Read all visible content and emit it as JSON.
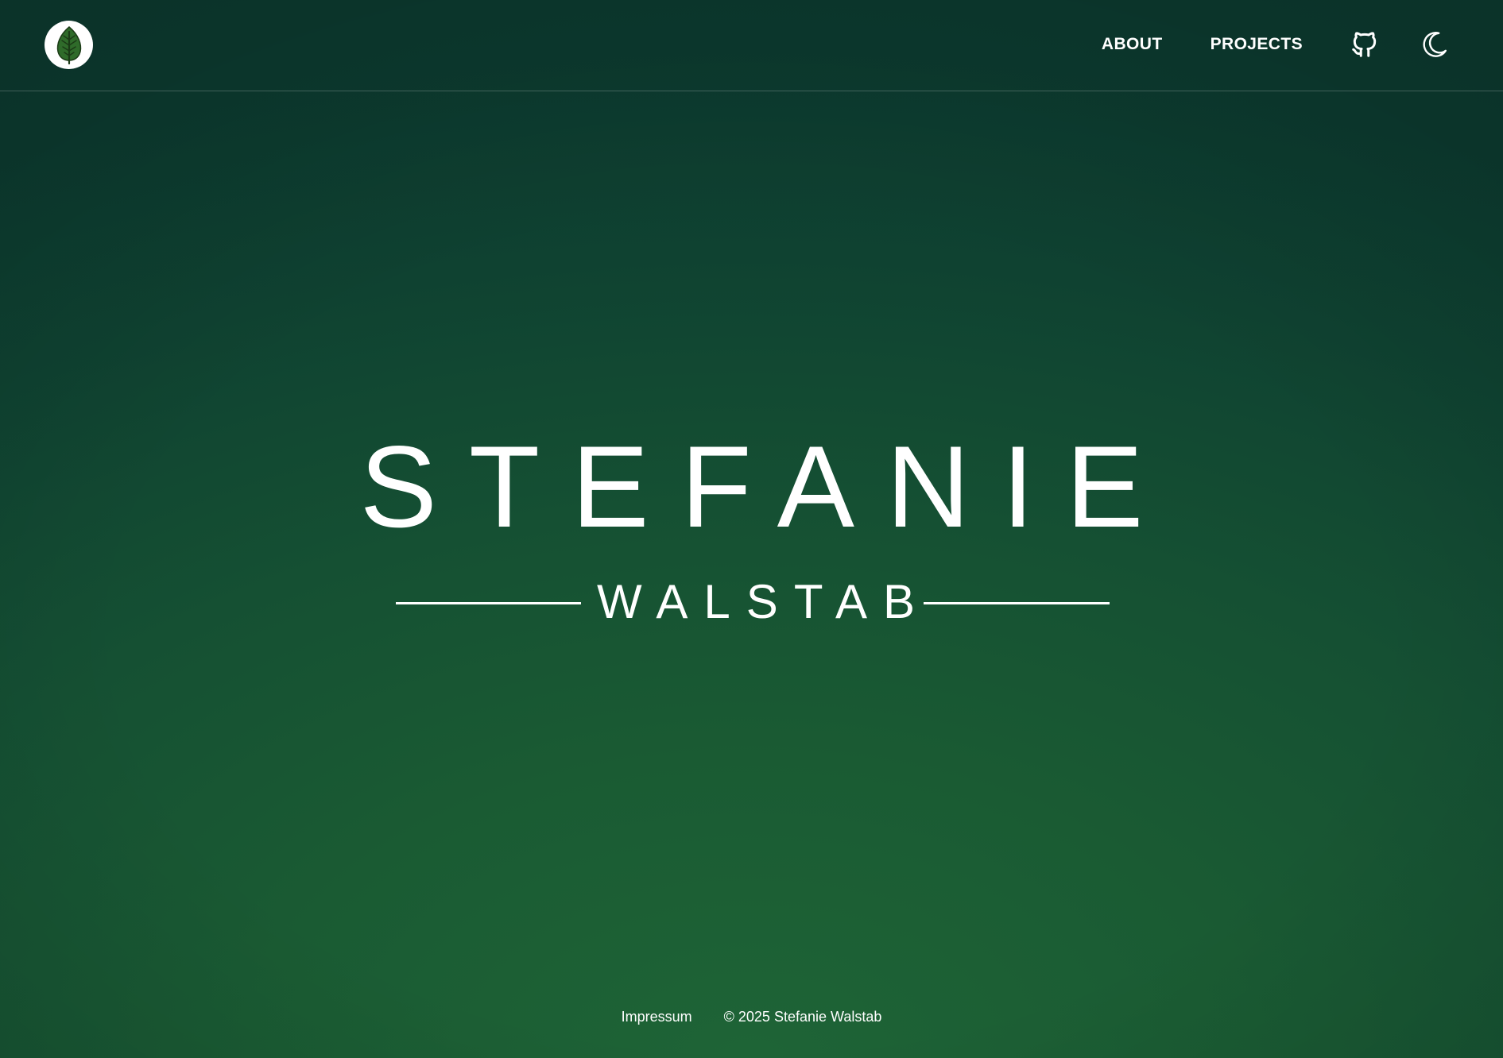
{
  "header": {
    "logo_icon": "leaf-icon",
    "nav": {
      "about_label": "ABOUT",
      "projects_label": "PROJECTS"
    },
    "github_icon": "github-icon",
    "theme_toggle_icon": "moon-icon"
  },
  "hero": {
    "first_name": "STEFANIE",
    "last_name": "WALSTAB"
  },
  "footer": {
    "impressum_label": "Impressum",
    "copyright": "© 2025 Stefanie Walstab"
  },
  "colors": {
    "background_top": "#0c3a2f",
    "background_bottom": "#1e6436",
    "text": "#ffffff",
    "logo_leaf": "#2f6b2a"
  }
}
